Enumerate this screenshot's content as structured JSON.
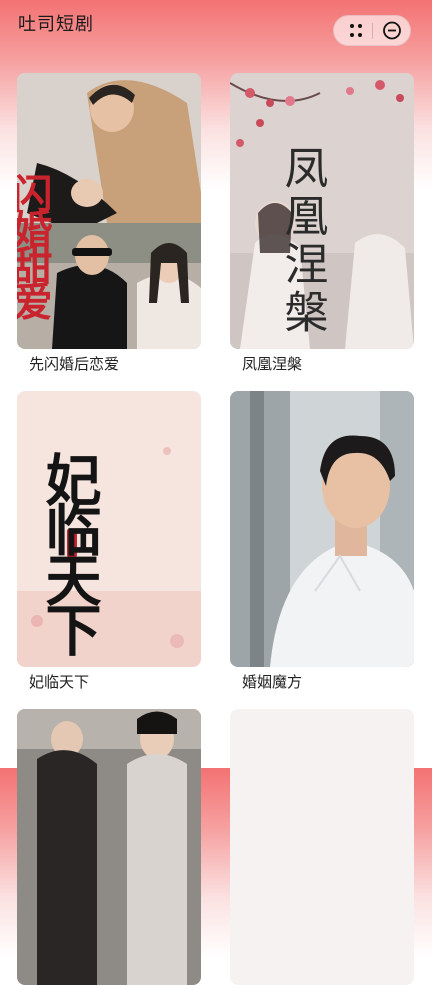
{
  "app": {
    "title": "吐司短剧"
  },
  "capsule": {
    "more_icon": "more-dots-icon",
    "close_icon": "minus-circle-icon"
  },
  "dramas": [
    {
      "title": "先闪婚后恋爱",
      "poster_text": "闪婚甜爱"
    },
    {
      "title": "凤凰涅槃",
      "poster_text": "凤凰涅槃"
    },
    {
      "title": "妃临天下",
      "poster_text": "妃临天下"
    },
    {
      "title": "婚姻魔方"
    },
    {
      "title": ""
    },
    {
      "title": ""
    }
  ],
  "colors": {
    "header_top": "#f47273",
    "text": "#222222",
    "poster_red": "#c9242e"
  }
}
